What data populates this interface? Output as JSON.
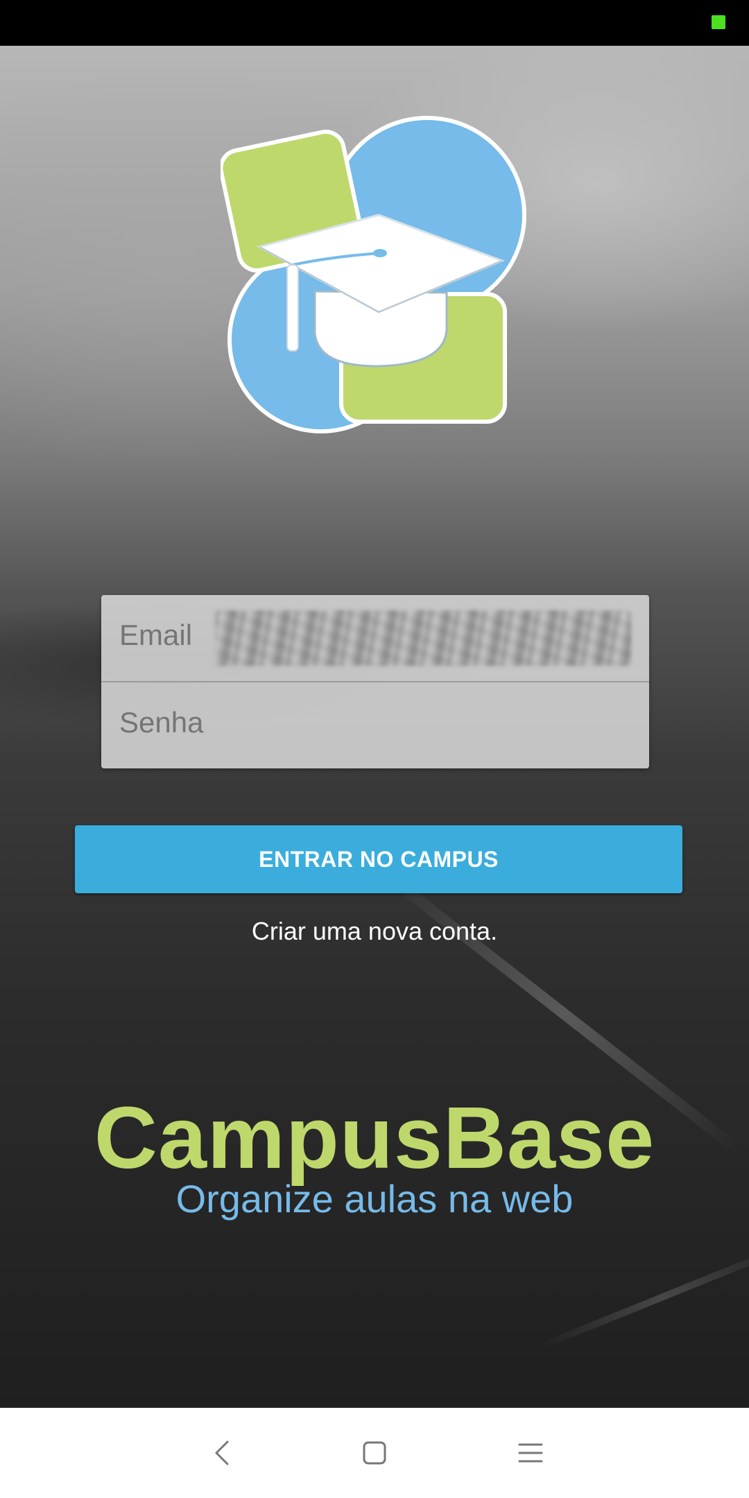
{
  "colors": {
    "brand_green": "#bed86c",
    "brand_blue": "#76bbe9",
    "button_blue": "#3aaddd",
    "status_indicator": "#4ce021"
  },
  "logo": {
    "icon": "graduation-cap-logo"
  },
  "login": {
    "email_label": "Email",
    "password_label": "Senha",
    "submit_label": "ENTRAR NO CAMPUS",
    "create_account_label": "Criar uma nova conta."
  },
  "brand": {
    "name": "CampusBase",
    "tagline": "Organize aulas na web"
  },
  "nav": {
    "back_icon": "back-icon",
    "home_icon": "home-icon",
    "menu_icon": "menu-icon"
  }
}
